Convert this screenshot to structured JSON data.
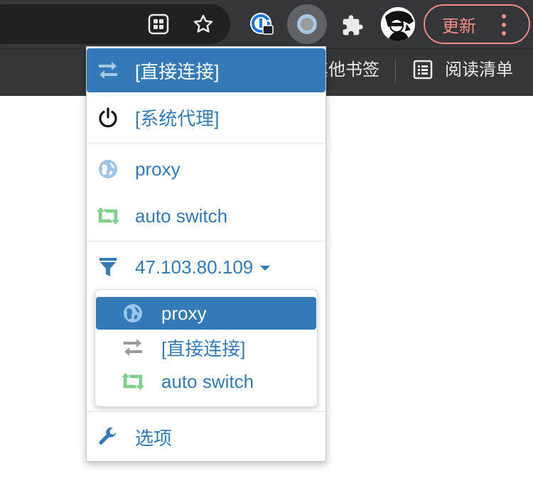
{
  "browser": {
    "update_label": "更新",
    "bookmarks_bar": {
      "other_bookmarks": "其他书签",
      "reading_list": "阅读清单"
    }
  },
  "popup": {
    "items": [
      {
        "label": "[直接连接]",
        "icon": "transfer-arrows-icon",
        "active": true
      },
      {
        "label": "[系统代理]",
        "icon": "power-icon"
      },
      {
        "label": "proxy",
        "icon": "globe-icon"
      },
      {
        "label": "auto switch",
        "icon": "retweet-icon"
      },
      {
        "label": "47.103.80.109",
        "icon": "filter-icon",
        "dropdown": true
      }
    ],
    "submenu": [
      {
        "label": "proxy",
        "icon": "globe-icon",
        "active": true
      },
      {
        "label": "[直接连接]",
        "icon": "transfer-arrows-icon"
      },
      {
        "label": "auto switch",
        "icon": "retweet-icon"
      }
    ],
    "options_label": "选项"
  },
  "colors": {
    "accent": "#337ab7",
    "chrome_bg": "#35363a",
    "update_red": "#f28b82",
    "switch_green": "#7fd08a"
  }
}
